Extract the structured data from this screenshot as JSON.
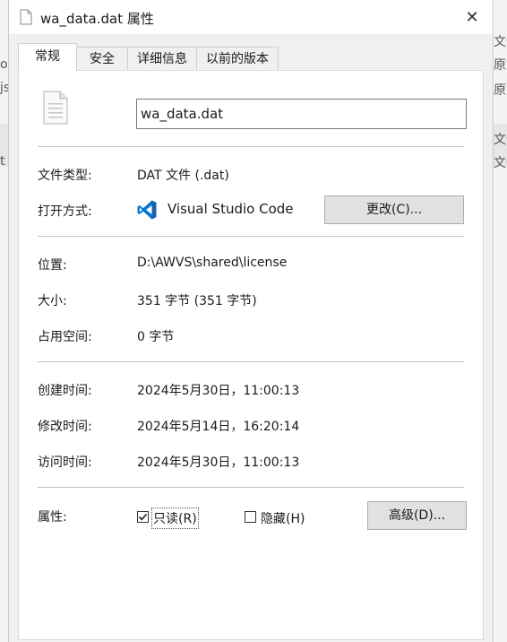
{
  "window": {
    "title": "wa_data.dat 属性",
    "close_symbol": "✕"
  },
  "background": {
    "left_fragments": [
      "or",
      "js",
      "t"
    ],
    "right_fragments": [
      "文件",
      "原文",
      "原文",
      "文件",
      "文件"
    ]
  },
  "tabs": [
    {
      "label": "常规",
      "active": true
    },
    {
      "label": "安全",
      "active": false
    },
    {
      "label": "详细信息",
      "active": false
    },
    {
      "label": "以前的版本",
      "active": false
    }
  ],
  "file": {
    "name": "wa_data.dat"
  },
  "details": {
    "file_type_label": "文件类型:",
    "file_type_value": "DAT 文件 (.dat)",
    "open_with_label": "打开方式:",
    "open_with_app": "Visual Studio Code",
    "change_button": "更改(C)...",
    "location_label": "位置:",
    "location_value": "D:\\AWVS\\shared\\license",
    "size_label": "大小:",
    "size_value": "351 字节 (351 字节)",
    "disk_size_label": "占用空间:",
    "disk_size_value": "0 字节",
    "created_label": "创建时间:",
    "created_value": "2024年5月30日，11:00:13",
    "modified_label": "修改时间:",
    "modified_value": "2024年5月14日，16:20:14",
    "accessed_label": "访问时间:",
    "accessed_value": "2024年5月30日，11:00:13"
  },
  "attributes": {
    "label": "属性:",
    "readonly_label": "只读(R)",
    "readonly_checked": true,
    "hidden_label": "隐藏(H)",
    "hidden_checked": false,
    "advanced_button": "高级(D)..."
  },
  "colors": {
    "vscode_blue": "#0078d4",
    "vscode_dark": "#1f5fa8"
  }
}
